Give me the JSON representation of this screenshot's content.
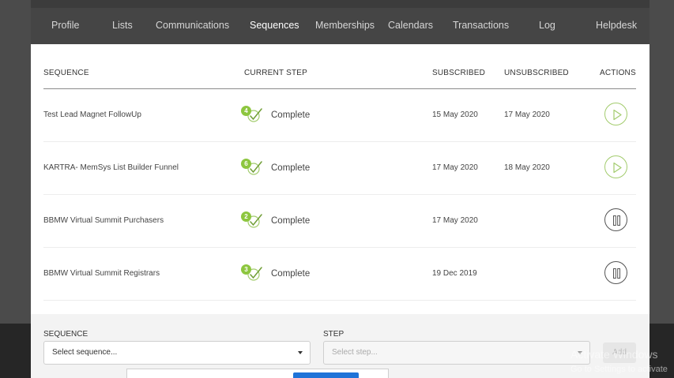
{
  "tabs": [
    {
      "label": "Profile",
      "active": false
    },
    {
      "label": "Lists",
      "active": false
    },
    {
      "label": "Communications",
      "active": false
    },
    {
      "label": "Sequences",
      "active": true
    },
    {
      "label": "Memberships",
      "active": false
    },
    {
      "label": "Calendars",
      "active": false
    },
    {
      "label": "Transactions",
      "active": false
    },
    {
      "label": "Log",
      "active": false
    },
    {
      "label": "Helpdesk",
      "active": false
    }
  ],
  "table": {
    "headers": {
      "sequence": "SEQUENCE",
      "current_step": "CURRENT STEP",
      "subscribed": "SUBSCRIBED",
      "unsubscribed": "UNSUBSCRIBED",
      "actions": "ACTIONS"
    },
    "rows": [
      {
        "sequence": "Test Lead Magnet FollowUp",
        "step_number": "4",
        "step_status": "Complete",
        "subscribed": "15 May 2020",
        "unsubscribed": "17 May 2020",
        "action_icon": "play-icon"
      },
      {
        "sequence": "KARTRA- MemSys List Builder Funnel",
        "step_number": "6",
        "step_status": "Complete",
        "subscribed": "17 May 2020",
        "unsubscribed": "18 May 2020",
        "action_icon": "play-icon"
      },
      {
        "sequence": "BBMW Virtual Summit Purchasers",
        "step_number": "2",
        "step_status": "Complete",
        "subscribed": "17 May 2020",
        "unsubscribed": "",
        "action_icon": "pause-icon"
      },
      {
        "sequence": "BBMW Virtual Summit Registrars",
        "step_number": "3",
        "step_status": "Complete",
        "subscribed": "19 Dec 2019",
        "unsubscribed": "",
        "action_icon": "pause-icon"
      }
    ]
  },
  "form": {
    "sequence_label": "SEQUENCE",
    "sequence_value": "Select sequence...",
    "step_label": "STEP",
    "step_value": "Select step...",
    "add_label": "Add"
  },
  "watermark": {
    "title": "Activate Windows",
    "subtitle": "Go to Settings to activate"
  },
  "colors": {
    "accent_green": "#8dc63f",
    "tab_bar": "#454545",
    "button_blue": "#1f73d8"
  }
}
